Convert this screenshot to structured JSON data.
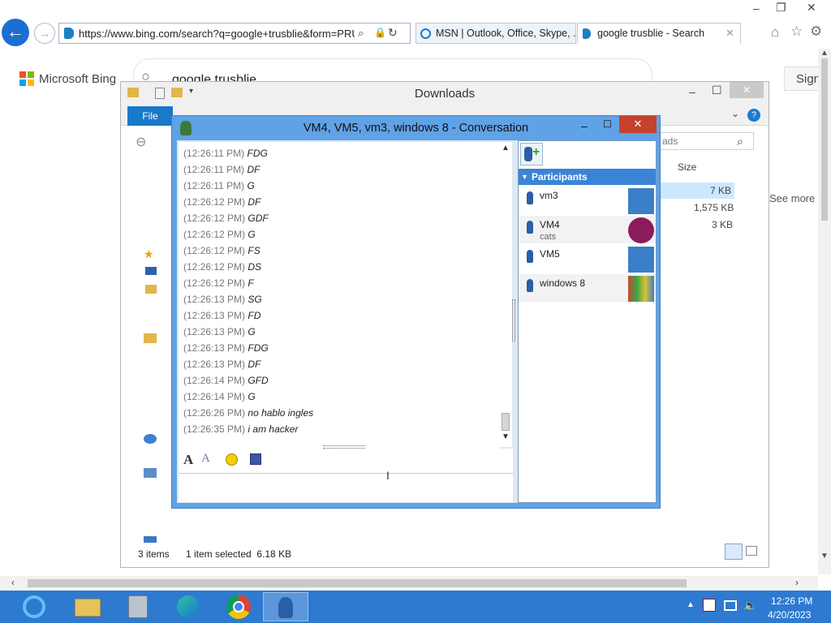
{
  "browser": {
    "url": "https://www.bing.com/search?q=google+trusblie&form=PRUSE",
    "tabs": [
      {
        "label": "MSN | Outlook, Office, Skype, ..."
      },
      {
        "label": "google trusblie - Search"
      }
    ],
    "window_controls": {
      "minimize": "–",
      "restore": "❐",
      "close": "✕"
    }
  },
  "bing": {
    "logo_text": "Microsoft Bing",
    "query": "google trusblie",
    "sign_in": "Sign",
    "see_more": "See more"
  },
  "explorer": {
    "title": "Downloads",
    "file_tab": "File",
    "search_placeholder": "ads",
    "size_header": "Size",
    "sizes": [
      "7 KB",
      "1,575 KB",
      "3 KB"
    ],
    "status_items": "3 items",
    "status_selected": "1 item selected  6.18 KB"
  },
  "conversation": {
    "title": "VM4, VM5, vm3, windows 8 - Conversation",
    "messages": [
      {
        "time": "(12:26:11 PM)",
        "text": "FDG"
      },
      {
        "time": "(12:26:11 PM)",
        "text": "DF"
      },
      {
        "time": "(12:26:11 PM)",
        "text": "G"
      },
      {
        "time": "(12:26:12 PM)",
        "text": "DF"
      },
      {
        "time": "(12:26:12 PM)",
        "text": "GDF"
      },
      {
        "time": "(12:26:12 PM)",
        "text": "G"
      },
      {
        "time": "(12:26:12 PM)",
        "text": "FS"
      },
      {
        "time": "(12:26:12 PM)",
        "text": "DS"
      },
      {
        "time": "(12:26:12 PM)",
        "text": "F"
      },
      {
        "time": "(12:26:13 PM)",
        "text": "SG"
      },
      {
        "time": "(12:26:13 PM)",
        "text": "FD"
      },
      {
        "time": "(12:26:13 PM)",
        "text": "G"
      },
      {
        "time": "(12:26:13 PM)",
        "text": "FDG"
      },
      {
        "time": "(12:26:13 PM)",
        "text": "DF"
      },
      {
        "time": "(12:26:14 PM)",
        "text": "GFD"
      },
      {
        "time": "(12:26:14 PM)",
        "text": "G"
      },
      {
        "time": "(12:26:26 PM)",
        "text": "no hablo ingles"
      },
      {
        "time": "(12:26:35 PM)",
        "text": "i am hacker"
      }
    ],
    "participants_header": "Participants",
    "participants": [
      {
        "name": "vm3",
        "status": "",
        "avatar_color": "#3a7fc9"
      },
      {
        "name": "VM4",
        "status": "cats",
        "avatar_color": "#8a1c5a"
      },
      {
        "name": "VM5",
        "status": "",
        "avatar_color": "#3a7fc9"
      },
      {
        "name": "windows 8",
        "status": "",
        "avatar_color": "#c84a2a"
      }
    ],
    "icons": [
      "font-icon",
      "font-color-icon",
      "emoticon-icon",
      "save-icon",
      "invite-icon"
    ]
  },
  "taskbar": {
    "time": "12:26 PM",
    "date": "4/20/2023",
    "apps": [
      "internet-explorer-icon",
      "file-explorer-icon",
      "server-manager-icon",
      "edge-icon",
      "chrome-icon",
      "pidgin-icon"
    ]
  }
}
